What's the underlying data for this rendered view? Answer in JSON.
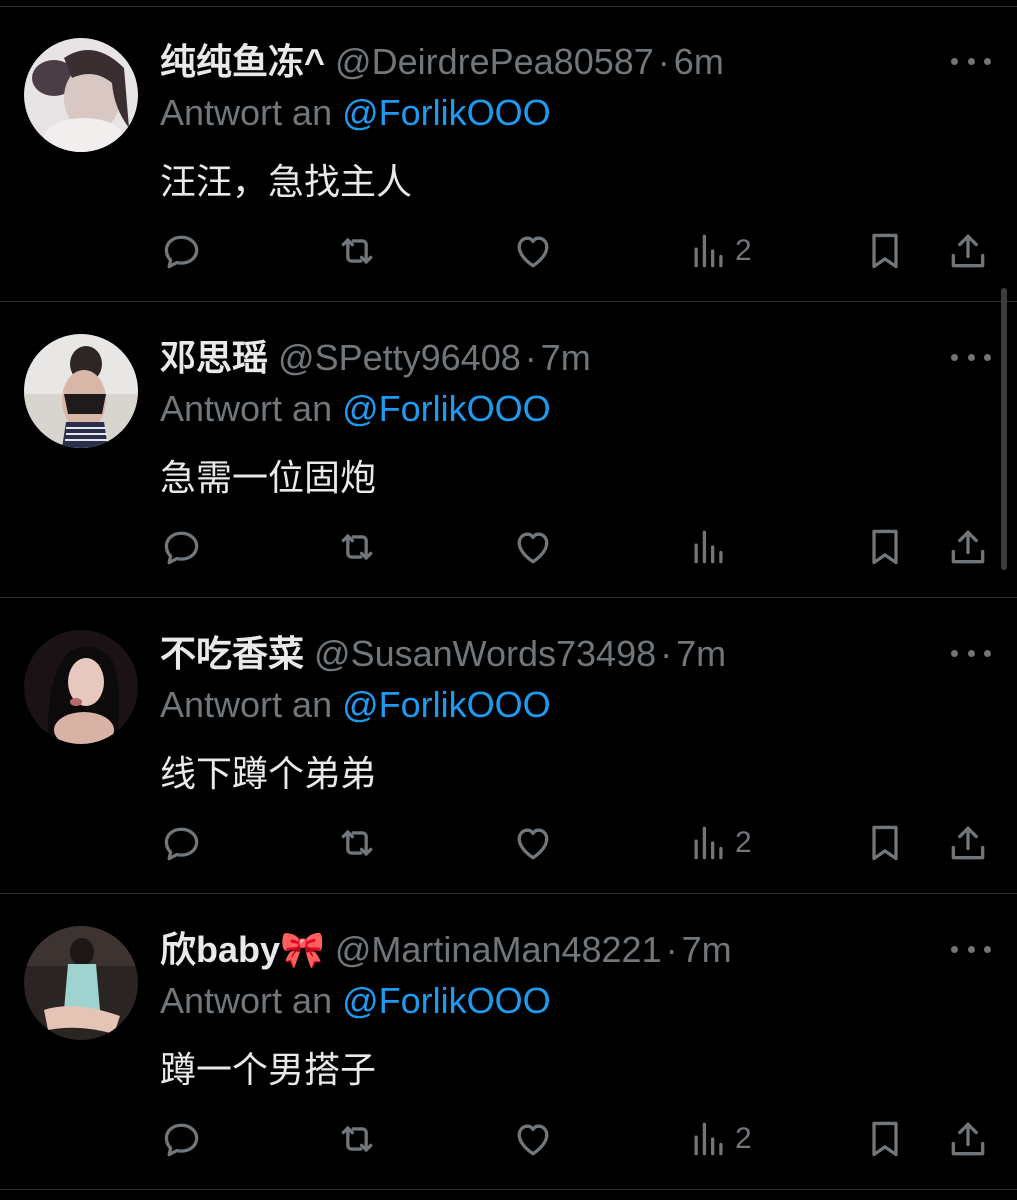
{
  "colors": {
    "background": "#000000",
    "text_primary": "#e7e9ea",
    "text_secondary": "#71767b",
    "accent_mention": "#1d9bf0",
    "divider": "#2f3336"
  },
  "icons": {
    "reply": "speech-bubble-icon",
    "retweet": "retweet-arrows-icon",
    "like": "heart-outline-icon",
    "views": "bar-chart-icon",
    "bookmark": "bookmark-icon",
    "share": "upload-share-icon",
    "more": "three-dots-icon"
  },
  "tweets": [
    {
      "display_name": "纯纯鱼冻^",
      "handle": "@DeirdrePea80587",
      "separator": "·",
      "time": "6m",
      "reply_prefix": "Antwort an",
      "reply_to": "@ForlikOOO",
      "text": "汪汪，急找主人",
      "views": "2"
    },
    {
      "display_name": "邓思瑶",
      "handle": "@SPetty96408",
      "separator": "·",
      "time": "7m",
      "reply_prefix": "Antwort an",
      "reply_to": "@ForlikOOO",
      "text": "急需一位固炮",
      "views": ""
    },
    {
      "display_name": "不吃香菜",
      "handle": "@SusanWords73498",
      "separator": "·",
      "time": "7m",
      "reply_prefix": "Antwort an",
      "reply_to": "@ForlikOOO",
      "text": "线下蹲个弟弟",
      "views": "2"
    },
    {
      "display_name": "欣baby🎀",
      "handle": "@MartinaMan48221",
      "separator": "·",
      "time": "7m",
      "reply_prefix": "Antwort an",
      "reply_to": "@ForlikOOO",
      "text": "蹲一个男搭子",
      "views": "2"
    }
  ]
}
